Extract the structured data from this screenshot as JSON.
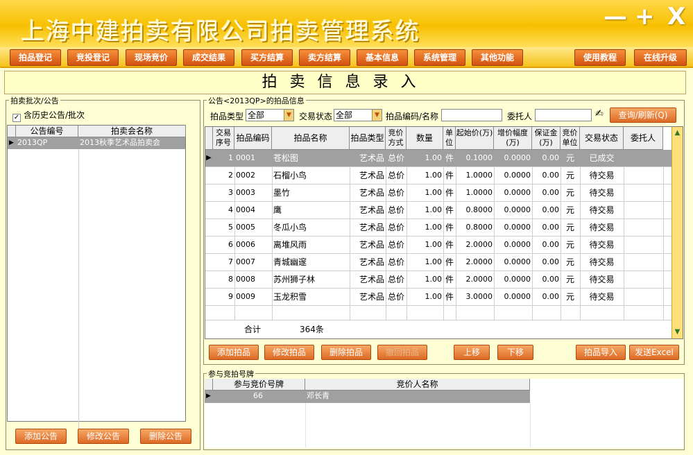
{
  "window": {
    "title": "上海中建拍卖有限公司拍卖管理系统",
    "controls": {
      "minimize": "—",
      "maximize": "+",
      "close": "X"
    }
  },
  "menu": {
    "items": [
      "拍品登记",
      "竞投登记",
      "现场竞价",
      "成交结果",
      "买方结算",
      "卖方结算",
      "基本信息",
      "系统管理",
      "其他功能"
    ],
    "right_items": [
      "使用教程",
      "在线升级"
    ]
  },
  "page_title": "拍卖信息录入",
  "left_panel": {
    "group_title": "拍卖批次/公告",
    "include_history_label": "含历史公告/批次",
    "include_history_checked": true,
    "columns": [
      "公告编号",
      "拍卖会名称"
    ],
    "rows": [
      {
        "code": "2013QP",
        "name": "2013秋季艺术品拍卖会"
      }
    ],
    "buttons": {
      "add": "添加公告",
      "edit": "修改公告",
      "delete": "删除公告"
    }
  },
  "items_panel": {
    "group_title": "公告<2013QP>的拍品信息",
    "filters": {
      "type_label": "拍品类型",
      "type_value": "全部",
      "status_label": "交易状态",
      "status_value": "全部",
      "code_label": "拍品编码/名称",
      "code_value": "",
      "consignor_label": "委托人",
      "consignor_value": "",
      "query_button": "查询/刷新(Q)"
    },
    "columns": [
      "交易序号",
      "拍品编码",
      "拍品名称",
      "拍品类型",
      "竞价方式",
      "数量",
      "单位",
      "起始价(万)",
      "增价幅度(万)",
      "保证金(万)",
      "竞价单位",
      "交易状态",
      "委托人"
    ],
    "rows": [
      {
        "seq": "1",
        "code": "0001",
        "name": "苍松图",
        "type": "艺术品",
        "mode": "总价",
        "qty": "1.00",
        "unit": "件",
        "start": "0.1000",
        "step": "0.0000",
        "deposit": "0.00",
        "bidunit": "元",
        "status": "已成交",
        "consignor": ""
      },
      {
        "seq": "2",
        "code": "0002",
        "name": "石榴小鸟",
        "type": "艺术品",
        "mode": "总价",
        "qty": "1.00",
        "unit": "件",
        "start": "1.0000",
        "step": "0.0000",
        "deposit": "0.00",
        "bidunit": "元",
        "status": "待交易",
        "consignor": ""
      },
      {
        "seq": "3",
        "code": "0003",
        "name": "墨竹",
        "type": "艺术品",
        "mode": "总价",
        "qty": "1.00",
        "unit": "件",
        "start": "1.0000",
        "step": "0.0000",
        "deposit": "0.00",
        "bidunit": "元",
        "status": "待交易",
        "consignor": ""
      },
      {
        "seq": "4",
        "code": "0004",
        "name": "鹰",
        "type": "艺术品",
        "mode": "总价",
        "qty": "1.00",
        "unit": "件",
        "start": "0.8000",
        "step": "0.0000",
        "deposit": "0.00",
        "bidunit": "元",
        "status": "待交易",
        "consignor": ""
      },
      {
        "seq": "5",
        "code": "0005",
        "name": "冬瓜小鸟",
        "type": "艺术品",
        "mode": "总价",
        "qty": "1.00",
        "unit": "件",
        "start": "0.8000",
        "step": "0.0000",
        "deposit": "0.00",
        "bidunit": "元",
        "status": "待交易",
        "consignor": ""
      },
      {
        "seq": "6",
        "code": "0006",
        "name": "离堆风雨",
        "type": "艺术品",
        "mode": "总价",
        "qty": "1.00",
        "unit": "件",
        "start": "2.0000",
        "step": "0.0000",
        "deposit": "0.00",
        "bidunit": "元",
        "status": "待交易",
        "consignor": ""
      },
      {
        "seq": "7",
        "code": "0007",
        "name": "青城幽邃",
        "type": "艺术品",
        "mode": "总价",
        "qty": "1.00",
        "unit": "件",
        "start": "2.0000",
        "step": "0.0000",
        "deposit": "0.00",
        "bidunit": "元",
        "status": "待交易",
        "consignor": ""
      },
      {
        "seq": "8",
        "code": "0008",
        "name": "苏州狮子林",
        "type": "艺术品",
        "mode": "总价",
        "qty": "1.00",
        "unit": "件",
        "start": "2.0000",
        "step": "0.0000",
        "deposit": "0.00",
        "bidunit": "元",
        "status": "待交易",
        "consignor": ""
      },
      {
        "seq": "9",
        "code": "0009",
        "name": "玉龙积雪",
        "type": "艺术品",
        "mode": "总价",
        "qty": "1.00",
        "unit": "件",
        "start": "3.0000",
        "step": "0.0000",
        "deposit": "0.00",
        "bidunit": "元",
        "status": "待交易",
        "consignor": ""
      }
    ],
    "footer": {
      "label": "合计",
      "count": "364条"
    },
    "buttons": {
      "add": "添加拍品",
      "edit": "修改拍品",
      "delete": "删除拍品",
      "disabled": "撤回拍品",
      "up": "上移",
      "down": "下移",
      "import": "拍品导入",
      "excel": "发送Excel"
    }
  },
  "bidders_panel": {
    "group_title": "参与竞拍号牌",
    "columns": [
      "参与竞价号牌",
      "竞价人名称"
    ],
    "rows": [
      {
        "paddle": "66",
        "name": "邓长青"
      }
    ]
  }
}
